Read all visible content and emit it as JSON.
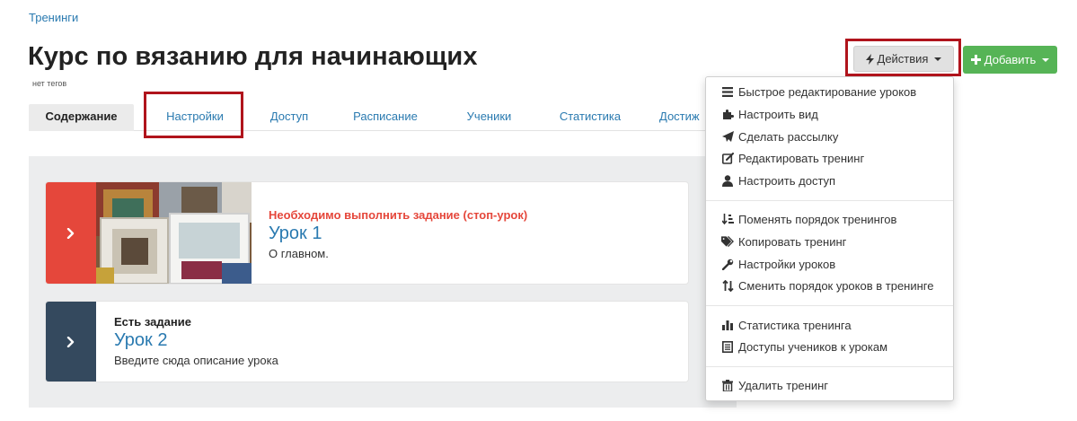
{
  "breadcrumb": "Тренинги",
  "title": "Курс по вязанию для начинающих",
  "tags": "нет тегов",
  "tabs": [
    "Содержание",
    "Настройки",
    "Доступ",
    "Расписание",
    "Ученики",
    "Статистика",
    "Достиж"
  ],
  "buttons": {
    "actions": "Действия",
    "add": "Добавить"
  },
  "lessons": [
    {
      "status": "Необходимо выполнить задание (стоп-урок)",
      "title": "Урок 1",
      "description": "О главном."
    },
    {
      "status": "Есть задание",
      "title": "Урок 2",
      "description": "Введите сюда описание урока"
    }
  ],
  "menu": {
    "group1": [
      "Быстрое редактирование уроков",
      "Настроить вид",
      "Сделать рассылку",
      "Редактировать тренинг",
      "Настроить доступ"
    ],
    "group2": [
      "Поменять порядок тренингов",
      "Копировать тренинг",
      "Настройки уроков",
      "Сменить порядок уроков в тренинге"
    ],
    "group3": [
      "Статистика тренинга",
      "Доступы учеников к урокам"
    ],
    "group4": [
      "Удалить тренинг"
    ]
  },
  "colors": {
    "link": "#2a7ab0",
    "stop_lesson": "#e5473b",
    "task_lesson": "#34495e",
    "add_button": "#56b456",
    "highlight": "#b0141c"
  }
}
